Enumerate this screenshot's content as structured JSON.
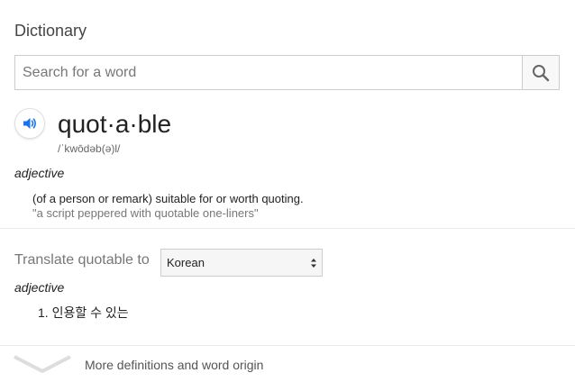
{
  "header": {
    "title": "Dictionary"
  },
  "search": {
    "placeholder": "Search for a word",
    "value": ""
  },
  "entry": {
    "headword": "quot·a·ble",
    "phonetic": "/ˈkwōdəb(ə)l/",
    "part_of_speech": "adjective",
    "definition": "(of a person or remark) suitable for or worth quoting.",
    "example": "\"a script peppered with quotable one-liners\""
  },
  "translate": {
    "label": "Translate quotable to",
    "selected_language": "Korean",
    "part_of_speech": "adjective",
    "translation": "1. 인용할 수 있는"
  },
  "footer": {
    "more_label": "More definitions and word origin"
  },
  "colors": {
    "speaker_blue": "#1a73e8",
    "muted_text": "#777777",
    "border": "#cccccc"
  },
  "icons": {
    "search": "search-icon",
    "speaker": "speaker-icon",
    "select": "select-arrows-icon",
    "expand": "chevron-down-icon"
  }
}
